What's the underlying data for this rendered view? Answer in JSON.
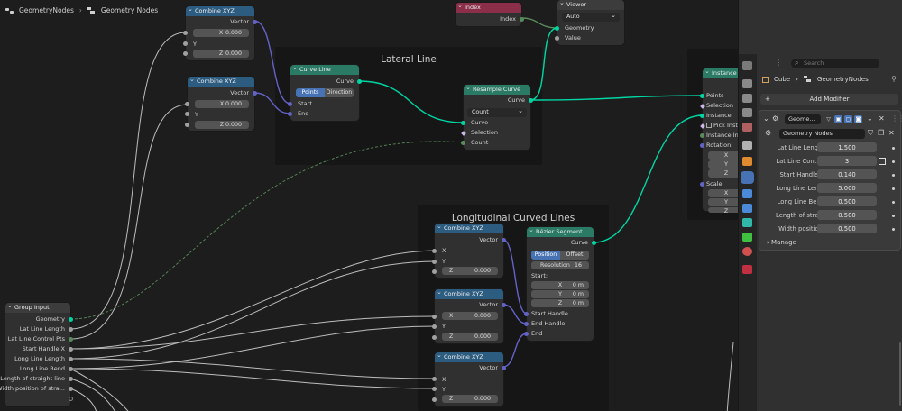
{
  "breadcrumb": {
    "tree_name": "GeometryNodes",
    "modifier_name": "Geometry Nodes"
  },
  "frames": {
    "lateral": "Lateral Line",
    "longitudinal": "Longitudinal  Curved Lines"
  },
  "nodes": {
    "combine_xyz_1": {
      "title": "Combine XYZ",
      "out": "Vector",
      "x_label": "X",
      "x": "0.000",
      "y_label": "Y",
      "z_label": "Z",
      "z": "0.000"
    },
    "combine_xyz_2": {
      "title": "Combine XYZ",
      "out": "Vector",
      "x_label": "X",
      "x": "0.000",
      "y_label": "Y",
      "z_label": "Z",
      "z": "0.000"
    },
    "curve_line": {
      "title": "Curve Line",
      "out": "Curve",
      "mode_points": "Points",
      "mode_direction": "Direction",
      "start": "Start",
      "end": "End"
    },
    "index": {
      "title": "Index",
      "out": "Index"
    },
    "viewer": {
      "title": "Viewer",
      "domain": "Auto",
      "geometry": "Geometry",
      "value": "Value"
    },
    "resample": {
      "title": "Resample Curve",
      "out": "Curve",
      "mode": "Count",
      "curve": "Curve",
      "selection": "Selection",
      "count": "Count"
    },
    "instance": {
      "title": "Instance",
      "points": "Points",
      "selection": "Selection",
      "instance": "Instance",
      "pick": "Pick Insta",
      "instance_index": "Instance Ind",
      "rotation": "Rotation:",
      "rx": "X",
      "ry": "Y",
      "rz": "Z",
      "scale": "Scale:",
      "sx": "X",
      "sy": "Y",
      "sz": "Z"
    },
    "combine_xyz_3": {
      "title": "Combine XYZ",
      "out": "Vector",
      "x_label": "X",
      "y_label": "Y",
      "z_label": "Z",
      "z": "0.000"
    },
    "combine_xyz_4": {
      "title": "Combine XYZ",
      "out": "Vector",
      "x_label": "X",
      "x": "0.000",
      "y_label": "Y",
      "z_label": "Z",
      "z": "0.000"
    },
    "combine_xyz_5": {
      "title": "Combine XYZ",
      "out": "Vector",
      "x_label": "X",
      "y_label": "Y",
      "z_label": "Z",
      "z": "0.000"
    },
    "bezier": {
      "title": "Bézier Segment",
      "out": "Curve",
      "mode_position": "Position",
      "mode_offset": "Offset",
      "res_label": "Resolution",
      "res": "16",
      "start": "Start:",
      "sx": "X",
      "sy": "Y",
      "sz": "Z",
      "sval": "0 m",
      "start_handle": "Start Handle",
      "end_handle": "End Handle",
      "end": "End"
    },
    "group_input": {
      "title": "Group Input",
      "outputs": [
        "Geometry",
        "Lat Line Length",
        "Lat Line Control Pts",
        "Start Handle X",
        "Long Line Length",
        "Long Line Bend",
        "Length of straight line",
        "Width position of stra..."
      ]
    }
  },
  "properties": {
    "search_placeholder": "Search",
    "object": "Cube",
    "tree": "GeometryNodes",
    "add_modifier": "Add Modifier",
    "modifier_short": "Geome...",
    "node_group": "Geometry Nodes",
    "inputs": [
      {
        "label": "Lat Line Length",
        "value": "1.500"
      },
      {
        "label": "Lat Line Contr...",
        "value": "3"
      },
      {
        "label": "Start Handle X",
        "value": "0.140"
      },
      {
        "label": "Long Line Len...",
        "value": "5.000"
      },
      {
        "label": "Long Line Bend",
        "value": "0.500"
      },
      {
        "label": "Length of stra...",
        "value": "0.500"
      },
      {
        "label": "Width positio...",
        "value": "0.500"
      }
    ],
    "manage": "Manage"
  },
  "colors": {
    "geometry": "#00d6a3",
    "vector": "#6363c7",
    "float": "#a1a1a1",
    "accent": "#4772b3"
  }
}
